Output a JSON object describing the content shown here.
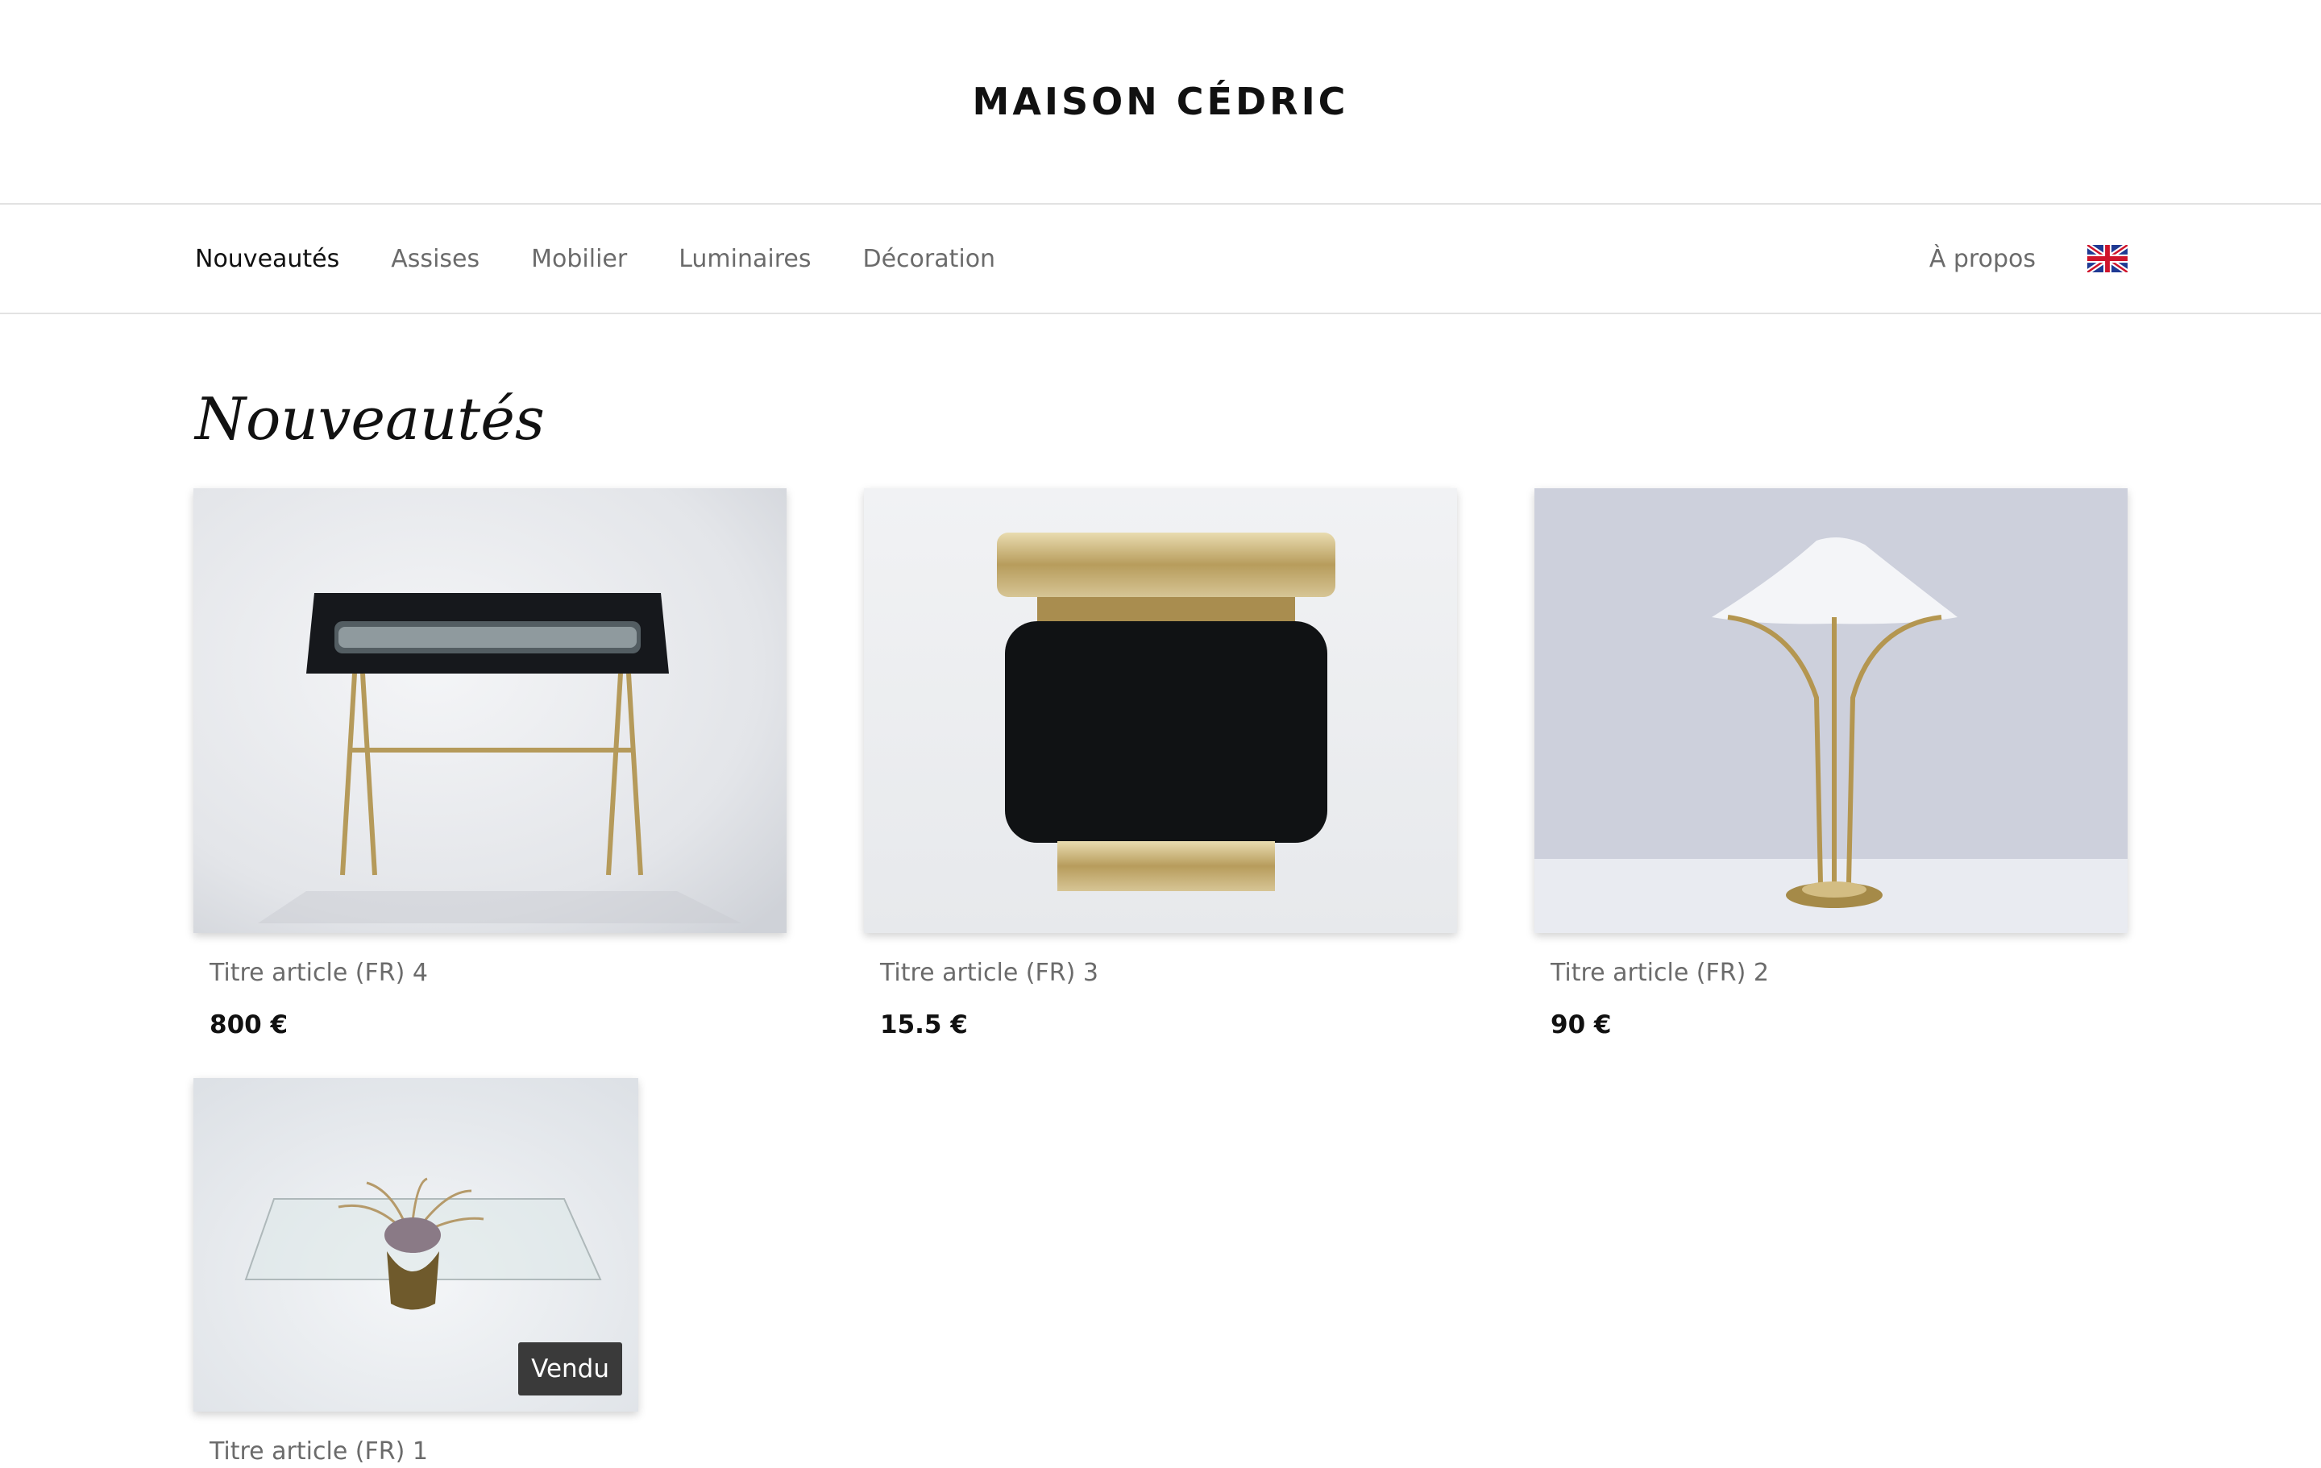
{
  "site": {
    "logo": "MAISON CÉDRIC"
  },
  "nav": {
    "items": [
      {
        "label": "Nouveautés",
        "active": true
      },
      {
        "label": "Assises",
        "active": false
      },
      {
        "label": "Mobilier",
        "active": false
      },
      {
        "label": "Luminaires",
        "active": false
      },
      {
        "label": "Décoration",
        "active": false
      }
    ],
    "about": "À propos",
    "language_flag": "uk-flag-icon"
  },
  "page": {
    "title": "Nouveautés"
  },
  "products": [
    {
      "title": "Titre article (FR) 4",
      "price": "800 €",
      "image": "black-tray-table-photo",
      "sold": false
    },
    {
      "title": "Titre article (FR) 3",
      "price": "15.5 €",
      "image": "black-brass-cabinet-photo",
      "sold": false
    },
    {
      "title": "Titre article (FR) 2",
      "price": "90 €",
      "image": "brass-table-lamp-photo",
      "sold": false
    },
    {
      "title": "Titre article (FR) 1",
      "price": "",
      "image": "glass-coffee-table-photo",
      "sold": true,
      "sold_label": "Vendu"
    }
  ],
  "colors": {
    "text": "#111111",
    "muted": "#6b6b6b",
    "divider": "#e2e2e2",
    "badge": "#3a3a3a"
  }
}
